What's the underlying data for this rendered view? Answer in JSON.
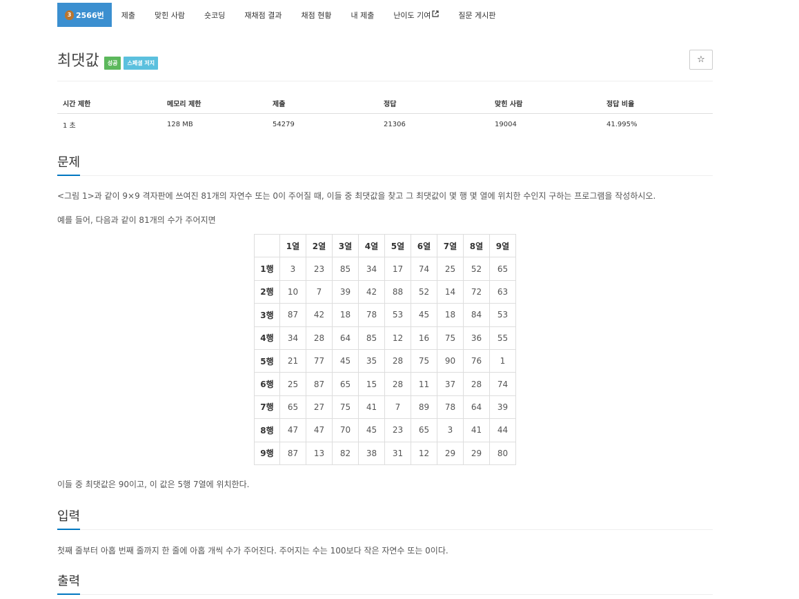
{
  "nav": {
    "problem_badge": "3",
    "problem_id": "2566번",
    "items": [
      "제출",
      "맞힌 사람",
      "숏코딩",
      "재채점 결과",
      "채점 현황",
      "내 제출",
      "난이도 기여",
      "질문 게시판"
    ],
    "external_icon": "external-link-icon"
  },
  "header": {
    "title": "최댓값",
    "label_success": "성공",
    "label_info": "스페셜 저지",
    "star": "☆"
  },
  "info": {
    "headers": [
      "시간 제한",
      "메모리 제한",
      "제출",
      "정답",
      "맞힌 사람",
      "정답 비율"
    ],
    "values": [
      "1 초",
      "128 MB",
      "54279",
      "21306",
      "19004",
      "41.995%"
    ]
  },
  "problem": {
    "heading": "문제",
    "paragraph1": "<그림 1>과 같이 9×9 격자판에 쓰여진 81개의 자연수 또는 0이 주어질 때, 이들 중 최댓값을 찾고 그 최댓값이 몇 행 몇 열에 위치한 수인지 구하는 프로그램을 작성하시오.",
    "paragraph2": "예를 들어, 다음과 같이 81개의 수가 주어지면",
    "grid_cols": [
      "1열",
      "2열",
      "3열",
      "4열",
      "5열",
      "6열",
      "7열",
      "8열",
      "9열"
    ],
    "grid_rows": [
      {
        "label": "1행",
        "cells": [
          "3",
          "23",
          "85",
          "34",
          "17",
          "74",
          "25",
          "52",
          "65"
        ]
      },
      {
        "label": "2행",
        "cells": [
          "10",
          "7",
          "39",
          "42",
          "88",
          "52",
          "14",
          "72",
          "63"
        ]
      },
      {
        "label": "3행",
        "cells": [
          "87",
          "42",
          "18",
          "78",
          "53",
          "45",
          "18",
          "84",
          "53"
        ]
      },
      {
        "label": "4행",
        "cells": [
          "34",
          "28",
          "64",
          "85",
          "12",
          "16",
          "75",
          "36",
          "55"
        ]
      },
      {
        "label": "5행",
        "cells": [
          "21",
          "77",
          "45",
          "35",
          "28",
          "75",
          "90",
          "76",
          "1"
        ]
      },
      {
        "label": "6행",
        "cells": [
          "25",
          "87",
          "65",
          "15",
          "28",
          "11",
          "37",
          "28",
          "74"
        ]
      },
      {
        "label": "7행",
        "cells": [
          "65",
          "27",
          "75",
          "41",
          "7",
          "89",
          "78",
          "64",
          "39"
        ]
      },
      {
        "label": "8행",
        "cells": [
          "47",
          "47",
          "70",
          "45",
          "23",
          "65",
          "3",
          "41",
          "44"
        ]
      },
      {
        "label": "9행",
        "cells": [
          "87",
          "13",
          "82",
          "38",
          "31",
          "12",
          "29",
          "29",
          "80"
        ]
      }
    ],
    "paragraph3": "이들 중 최댓값은 90이고, 이 값은 5행 7열에 위치한다."
  },
  "input": {
    "heading": "입력",
    "paragraph": "첫째 줄부터 아홉 번째 줄까지 한 줄에 아홉 개씩 수가 주어진다. 주어지는 수는 100보다 작은 자연수 또는 0이다."
  },
  "output": {
    "heading": "출력"
  }
}
